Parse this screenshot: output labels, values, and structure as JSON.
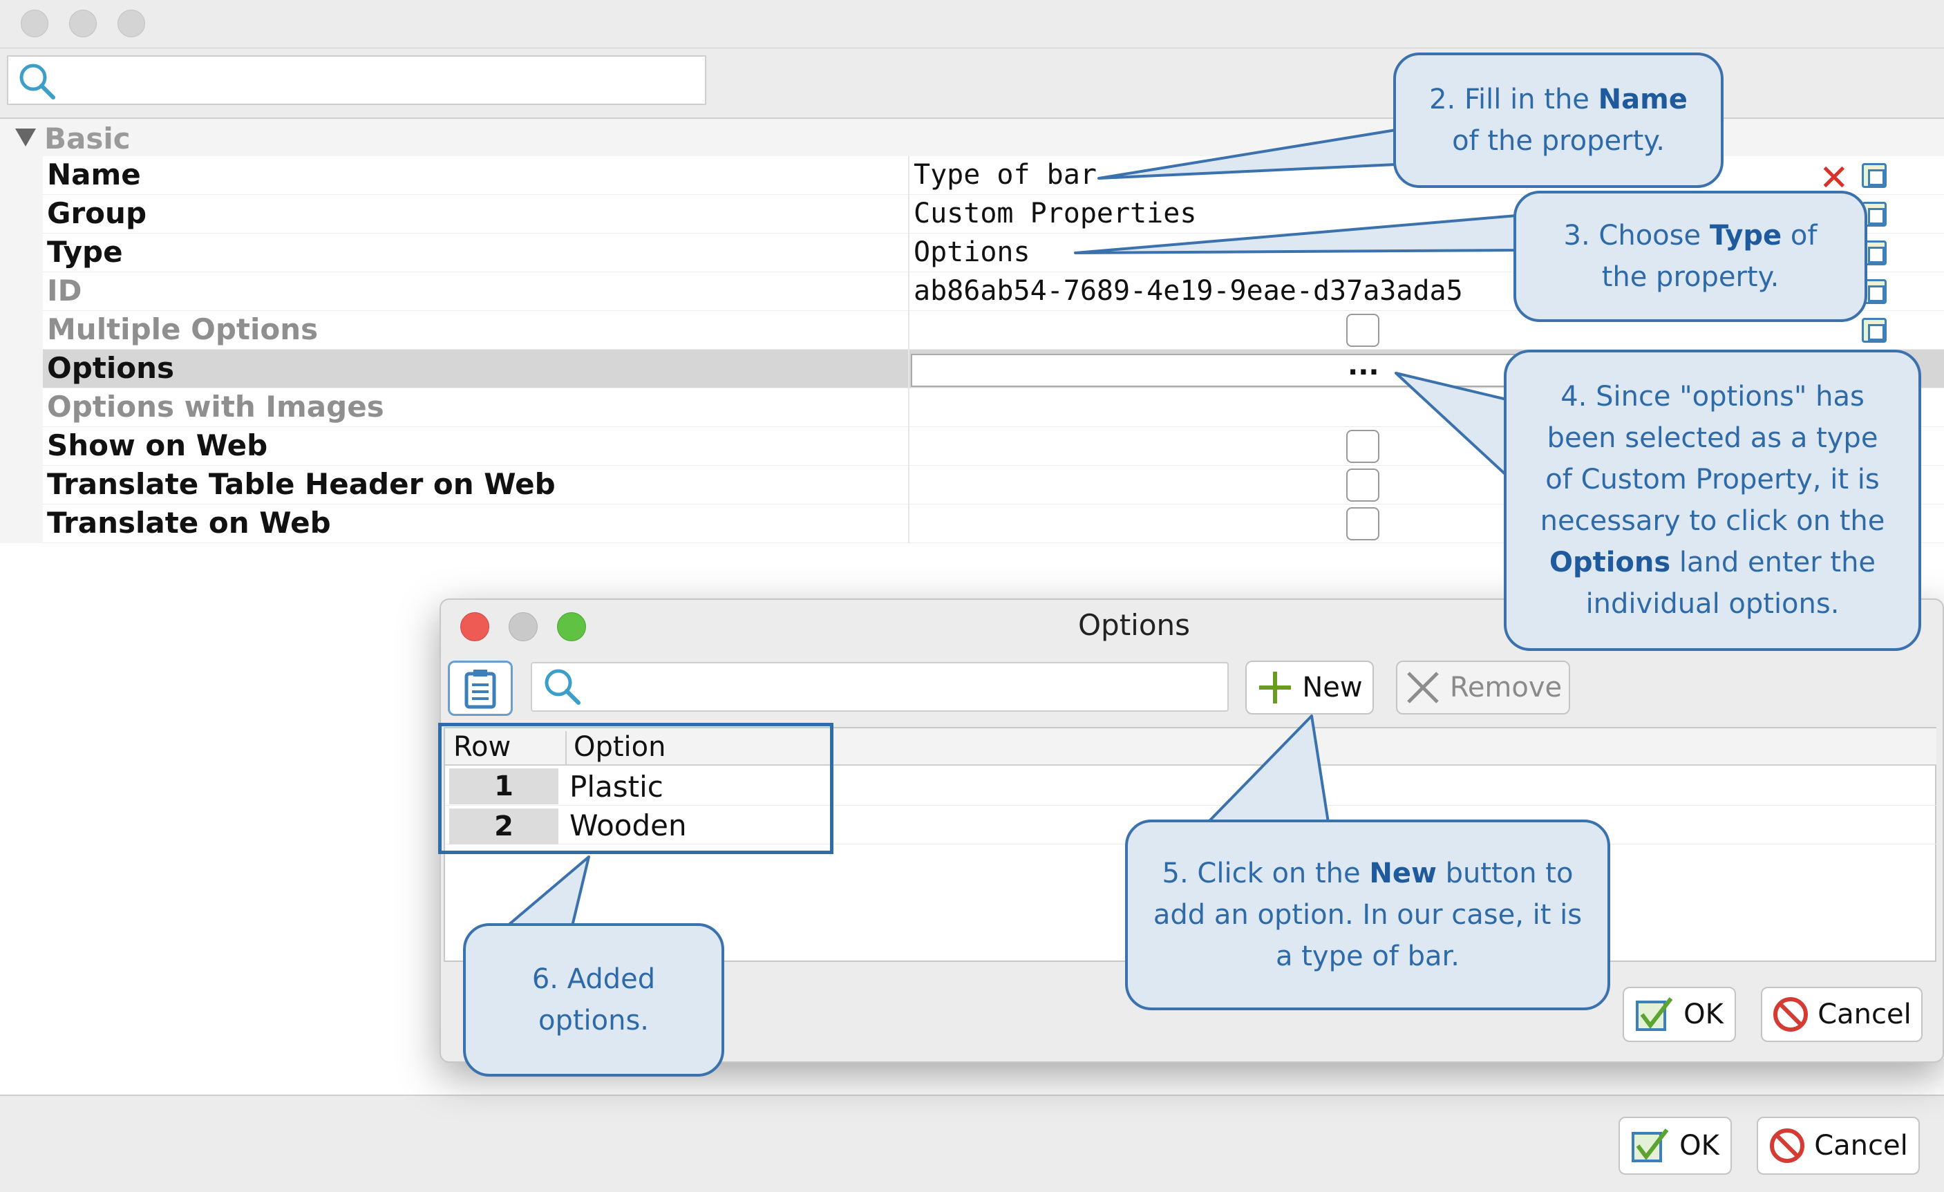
{
  "main": {
    "section_label": "Basic",
    "properties": [
      {
        "name": "Name",
        "value": "Type of bar"
      },
      {
        "name": "Group",
        "value": "Custom Properties"
      },
      {
        "name": "Type",
        "value": "Options"
      },
      {
        "name": "ID",
        "value": "ab86ab54-7689-4e19-9eae-d37a3ada5"
      },
      {
        "name": "Multiple Options",
        "value": ""
      },
      {
        "name": "Options",
        "value": "..."
      },
      {
        "name": "Options with Images",
        "value": ""
      },
      {
        "name": "Show on Web",
        "value": ""
      },
      {
        "name": "Translate Table Header on Web",
        "value": ""
      },
      {
        "name": "Translate on Web",
        "value": ""
      }
    ],
    "ok_label": "OK",
    "cancel_label": "Cancel"
  },
  "dialog": {
    "title": "Options",
    "new_label": "New",
    "remove_label": "Remove",
    "columns": [
      "Row",
      "Option"
    ],
    "rows": [
      {
        "row": "1",
        "option": "Plastic"
      },
      {
        "row": "2",
        "option": "Wooden"
      }
    ],
    "ok_label": "OK",
    "cancel_label": "Cancel"
  },
  "callouts": {
    "c2_pre": "2. Fill in the ",
    "c2_bold": "Name",
    "c2_post": "of the property.",
    "c3_pre": "3. Choose ",
    "c3_bold": "Type",
    "c3_mid": " of",
    "c3_post": "the property.",
    "c4_a": "4. Since \"options\" has",
    "c4_b": "been selected as a type",
    "c4_c": "of Custom Property, it is",
    "c4_d": "necessary to click on the",
    "c4_bold": "Options",
    "c4_e": " land enter the",
    "c4_f": "individual options.",
    "c5_pre": "5. Click on the ",
    "c5_bold": "New",
    "c5_mid": " button to",
    "c5_b": "add an option. In our case, it is",
    "c5_c": "a type of bar.",
    "c6_a": "6. Added",
    "c6_b": "options."
  },
  "colors": {
    "callout_fill": "#dde8f3",
    "callout_border": "#3b72ad",
    "callout_text": "#2f6aa8",
    "close_red": "#ee5b55",
    "min_gray": "#c9c9c9",
    "zoom_green": "#5fc243",
    "selected_row": "#d6d6d6"
  }
}
